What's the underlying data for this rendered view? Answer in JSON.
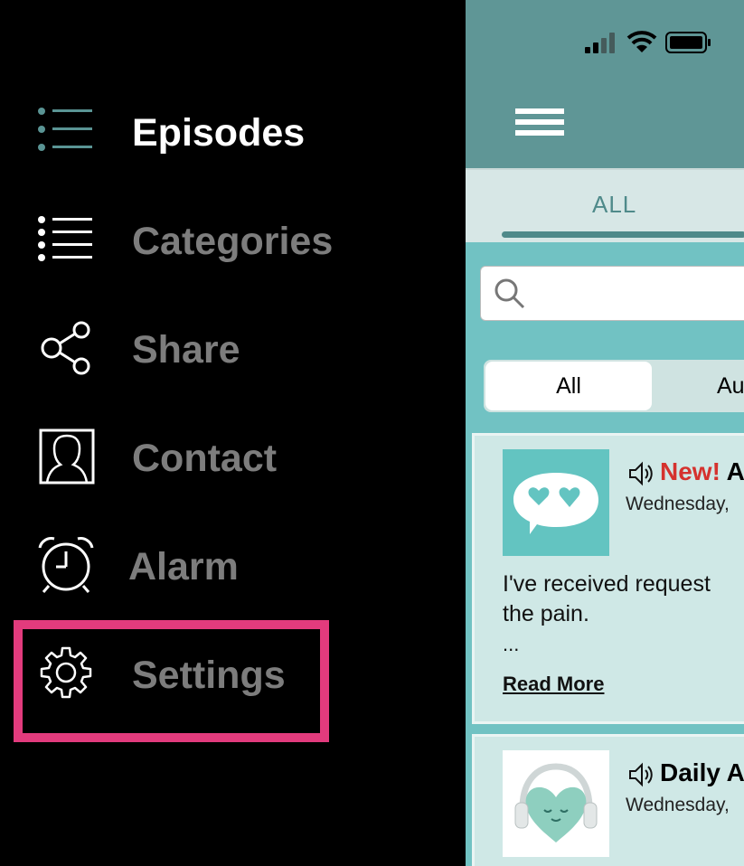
{
  "drawer": {
    "items": [
      {
        "label": "Episodes",
        "icon": "list-icon",
        "active": true
      },
      {
        "label": "Categories",
        "icon": "list-icon",
        "active": false
      },
      {
        "label": "Share",
        "icon": "share-icon",
        "active": false
      },
      {
        "label": "Contact",
        "icon": "contact-icon",
        "active": false
      },
      {
        "label": "Alarm",
        "icon": "alarm-clock-icon",
        "active": false
      },
      {
        "label": "Settings",
        "icon": "gear-icon",
        "active": false
      }
    ],
    "highlight_color": "#e23b7d",
    "active_color": "#ffffff",
    "inactive_color": "#7d7d7d"
  },
  "app": {
    "tabs": {
      "all_label": "ALL"
    },
    "search": {
      "placeholder": ""
    },
    "segment": {
      "options": [
        "All",
        "Au"
      ],
      "selected": "All"
    },
    "cards": [
      {
        "badge": "New!",
        "title_suffix": "A",
        "date": "Wednesday,",
        "excerpt_line1": "I've received request",
        "excerpt_line2": "the pain.",
        "ellipsis": "...",
        "read_more": "Read More"
      },
      {
        "title": "Daily A",
        "date": "Wednesday,"
      }
    ],
    "colors": {
      "topbar": "#5f9696",
      "background": "#71c2c3",
      "tabbar": "#d7e7e6",
      "card": "#cfe8e6",
      "accent": "#4f8a8a",
      "new_badge": "#d5322e"
    }
  }
}
